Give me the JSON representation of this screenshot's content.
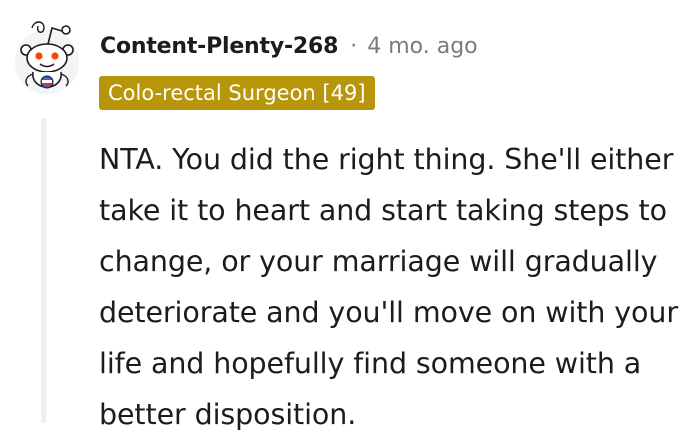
{
  "comment": {
    "author": "Content-Plenty-268",
    "separator": "·",
    "time_ago": "4 mo. ago",
    "flair": "Colo-rectal Surgeon [49]",
    "body": "NTA. You did the right thing. She'll either take it to heart and start taking steps to change, or your marriage will gradually deteriorate and you'll move on with your life and hopefully find someone with a better disposition.",
    "avatar_icon": "snoo-avatar-icon"
  },
  "colors": {
    "flair_background": "#b8960c",
    "flair_text": "#ffffff",
    "thread_line": "#edeff1",
    "meta_text": "#787c7e",
    "body_text": "#1c1c1c",
    "snoo_accent": "#ff4500"
  }
}
